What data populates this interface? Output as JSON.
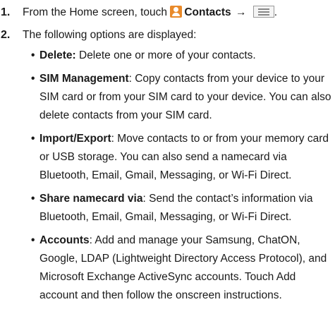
{
  "steps": [
    {
      "number": "1.",
      "prefix": "From the Home screen, touch",
      "app_label": "Contacts",
      "arrow": "→",
      "suffix": "."
    },
    {
      "number": "2.",
      "text": "The following options are displayed:"
    }
  ],
  "options": [
    {
      "term": "Delete:",
      "separator": "",
      "description": " Delete one or more of your contacts."
    },
    {
      "term": "SIM Management",
      "separator": ":",
      "description": " Copy contacts from your device to your SIM card or from your SIM card to your device. You can also delete contacts from your SIM card."
    },
    {
      "term": "Import/Export",
      "separator": ":",
      "description": " Move contacts to or from your memory card or USB storage. You can also send a namecard via Bluetooth, Email, Gmail, Messaging, or Wi-Fi Direct."
    },
    {
      "term": "Share namecard via",
      "separator": ":",
      "description": " Send the contact’s information via Bluetooth, Email, Gmail, Messaging, or Wi-Fi Direct."
    },
    {
      "term": "Accounts",
      "separator": ":",
      "description": " Add and manage your Samsung, ChatON, Google, LDAP (Lightweight Directory Access Protocol), and Microsoft Exchange ActiveSync accounts. Touch Add account and then follow the onscreen instructions."
    }
  ],
  "icons": {
    "contacts": "contacts-icon",
    "menu": "menu-icon"
  },
  "colors": {
    "contacts_icon": "#e98a2a"
  }
}
